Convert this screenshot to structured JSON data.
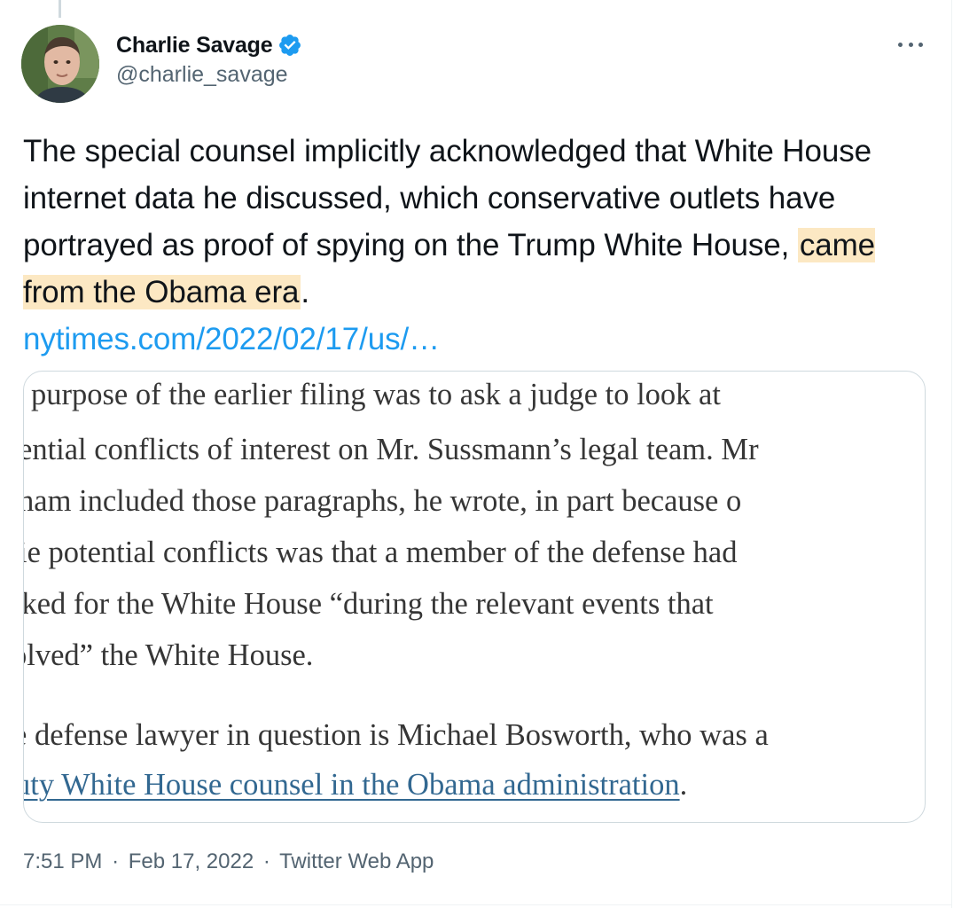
{
  "tweet": {
    "author": {
      "display_name": "Charlie Savage",
      "handle": "@charlie_savage",
      "verified": true
    },
    "text": {
      "part1": "The special counsel implicitly acknowledged that White House internet data he discussed, which conservative outlets have portrayed as proof of spying on the Trump White House, ",
      "highlighted": "came from the Obama era",
      "part2": ".",
      "link": "nytimes.com/2022/02/17/us/…"
    },
    "card": {
      "lines": [
        "purpose of the earlier filing was to ask a judge to look at",
        "ential conflicts of interest on Mr. Sussmann’s legal team. Mr",
        "ham included those paragraphs, he wrote, in part because o",
        "ie potential conflicts was that a member of the defense had",
        "rked for the White House “during the relevant events that",
        "olved” the White House.",
        "e defense lawyer in question is Michael Bosworth, who was a"
      ],
      "link_line": "uty White House counsel in the Obama administration",
      "link_line_end": "."
    },
    "meta": {
      "time": "7:51 PM",
      "separator": "·",
      "date": "Feb 17, 2022",
      "source": "Twitter Web App"
    },
    "colors": {
      "verified": "#1d9bf0",
      "link": "#1d9bf0",
      "highlight": "#fce8c3",
      "card_link": "#326891"
    }
  }
}
